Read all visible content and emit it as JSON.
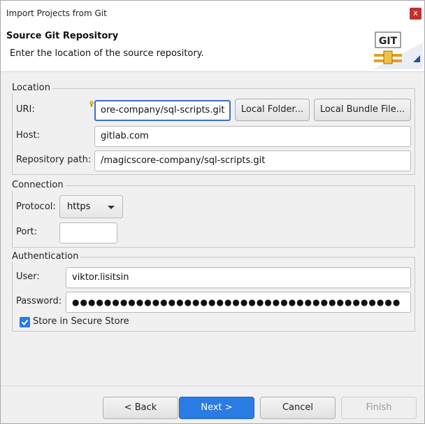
{
  "window": {
    "title": "Import Projects from Git",
    "close_glyph": "x"
  },
  "banner": {
    "heading": "Source Git Repository",
    "description": "Enter the location of the source repository.",
    "logo_text": "GIT"
  },
  "location": {
    "legend": "Location",
    "uri_label": "URI:",
    "uri_value": "ore-company/sql-scripts.git",
    "local_folder_button": "Local Folder...",
    "local_bundle_button": "Local Bundle File...",
    "host_label": "Host:",
    "host_value": "gitlab.com",
    "repo_path_label": "Repository path:",
    "repo_path_value": "/magicscore-company/sql-scripts.git"
  },
  "connection": {
    "legend": "Connection",
    "protocol_label": "Protocol:",
    "protocol_value": "https",
    "port_label": "Port:",
    "port_value": ""
  },
  "authentication": {
    "legend": "Authentication",
    "user_label": "User:",
    "user_value": "viktor.lisitsin",
    "password_label": "Password:",
    "password_value": "●●●●●●●●●●●●●●●●●●●●●●●●●●●●●●●●●●●●●●●●●",
    "store_label": "Store in Secure Store",
    "store_checked": true
  },
  "buttons": {
    "back": "< Back",
    "next": "Next >",
    "cancel": "Cancel",
    "finish": "Finish"
  },
  "colors": {
    "accent": "#2b7be5",
    "close": "#c4312d"
  }
}
